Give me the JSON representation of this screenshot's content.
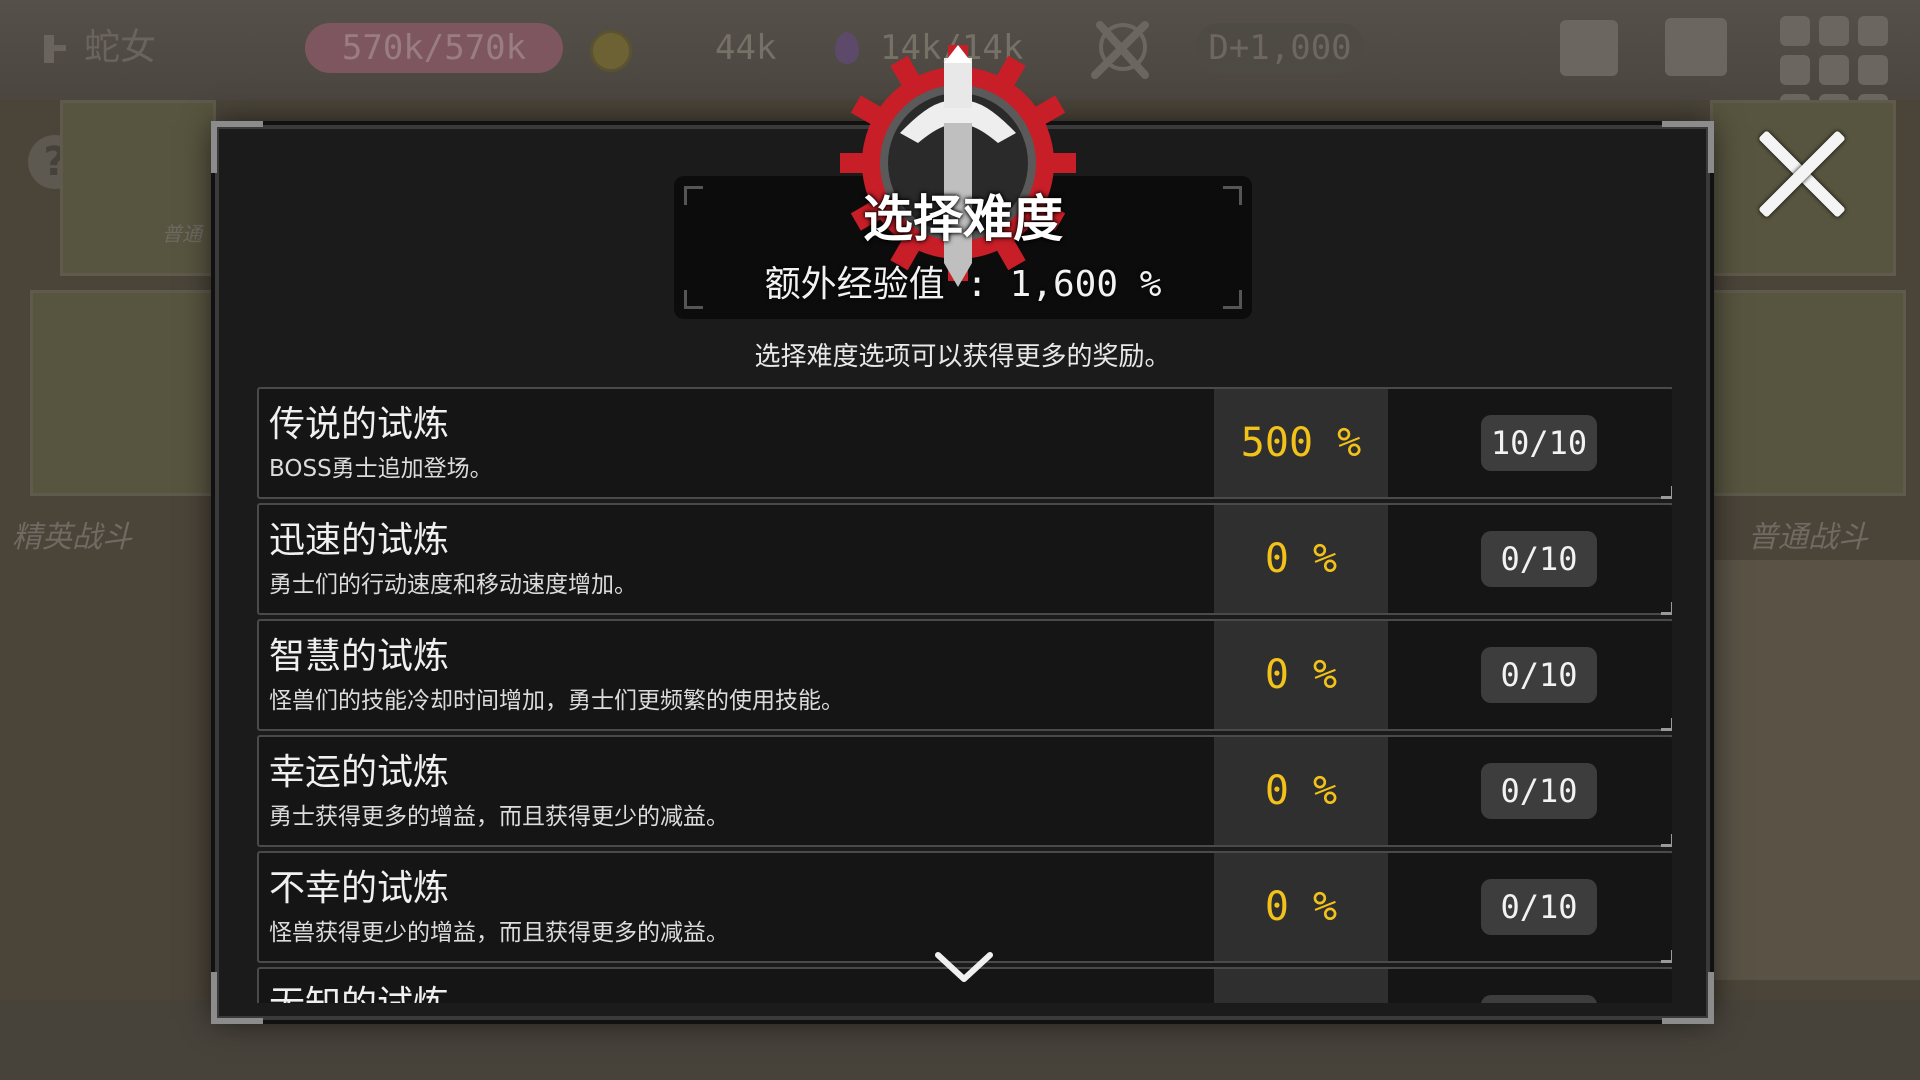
{
  "hud": {
    "character_name": "蛇女",
    "hp": "570k/570k",
    "gold": "44k",
    "mana": "14k/14k",
    "day": "D+1,000"
  },
  "background": {
    "left_label": "精英战斗",
    "right_label": "普通战斗",
    "small_label": "普通"
  },
  "dialog": {
    "title": "选择难度",
    "bonus_exp": "额外经验值 : 1,600 %",
    "description": "选择难度选项可以获得更多的奖励。",
    "trials": [
      {
        "name": "传说的试炼",
        "desc": "BOSS勇士追加登场。",
        "bonus": "500 %",
        "level": "10/10"
      },
      {
        "name": "迅速的试炼",
        "desc": "勇士们的行动速度和移动速度增加。",
        "bonus": "0 %",
        "level": "0/10"
      },
      {
        "name": "智慧的试炼",
        "desc": "怪兽们的技能冷却时间增加，勇士们更频繁的使用技能。",
        "bonus": "0 %",
        "level": "0/10"
      },
      {
        "name": "幸运的试炼",
        "desc": "勇士获得更多的增益，而且获得更少的减益。",
        "bonus": "0 %",
        "level": "0/10"
      },
      {
        "name": "不幸的试炼",
        "desc": "怪兽获得更少的增益，而且获得更多的减益。",
        "bonus": "0 %",
        "level": "0/10"
      },
      {
        "name": "无知的试炼",
        "desc": "",
        "bonus": "",
        "level": ""
      }
    ]
  },
  "colors": {
    "panel_bg": "#1b1b1b",
    "bonus_text": "#f2c21a",
    "emblem_red": "#c81e28"
  },
  "icons": [
    "character-icon",
    "coin-icon",
    "mana-icon",
    "crossed-swords-icon",
    "book-icon",
    "map-icon",
    "menu-grid-icon",
    "help-icon",
    "close-icon",
    "difficulty-emblem-icon",
    "chevron-down-icon"
  ]
}
